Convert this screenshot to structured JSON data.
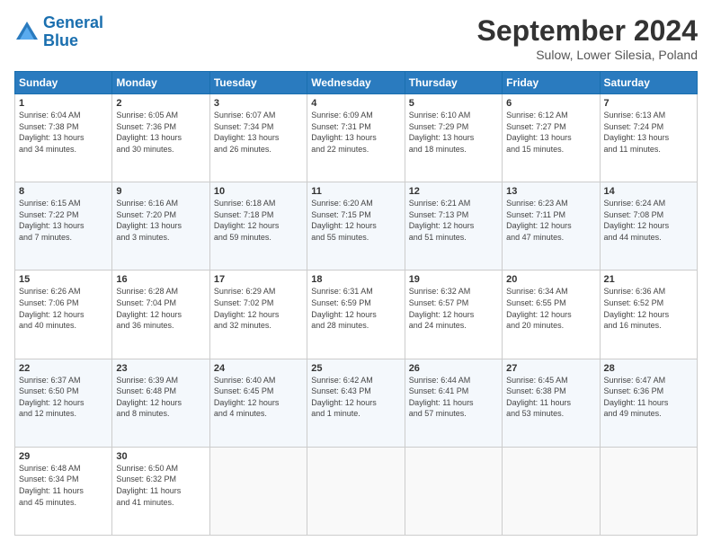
{
  "header": {
    "logo_line1": "General",
    "logo_line2": "Blue",
    "month_title": "September 2024",
    "subtitle": "Sulow, Lower Silesia, Poland"
  },
  "days_of_week": [
    "Sunday",
    "Monday",
    "Tuesday",
    "Wednesday",
    "Thursday",
    "Friday",
    "Saturday"
  ],
  "weeks": [
    [
      {
        "day": "1",
        "info": "Sunrise: 6:04 AM\nSunset: 7:38 PM\nDaylight: 13 hours\nand 34 minutes."
      },
      {
        "day": "2",
        "info": "Sunrise: 6:05 AM\nSunset: 7:36 PM\nDaylight: 13 hours\nand 30 minutes."
      },
      {
        "day": "3",
        "info": "Sunrise: 6:07 AM\nSunset: 7:34 PM\nDaylight: 13 hours\nand 26 minutes."
      },
      {
        "day": "4",
        "info": "Sunrise: 6:09 AM\nSunset: 7:31 PM\nDaylight: 13 hours\nand 22 minutes."
      },
      {
        "day": "5",
        "info": "Sunrise: 6:10 AM\nSunset: 7:29 PM\nDaylight: 13 hours\nand 18 minutes."
      },
      {
        "day": "6",
        "info": "Sunrise: 6:12 AM\nSunset: 7:27 PM\nDaylight: 13 hours\nand 15 minutes."
      },
      {
        "day": "7",
        "info": "Sunrise: 6:13 AM\nSunset: 7:24 PM\nDaylight: 13 hours\nand 11 minutes."
      }
    ],
    [
      {
        "day": "8",
        "info": "Sunrise: 6:15 AM\nSunset: 7:22 PM\nDaylight: 13 hours\nand 7 minutes."
      },
      {
        "day": "9",
        "info": "Sunrise: 6:16 AM\nSunset: 7:20 PM\nDaylight: 13 hours\nand 3 minutes."
      },
      {
        "day": "10",
        "info": "Sunrise: 6:18 AM\nSunset: 7:18 PM\nDaylight: 12 hours\nand 59 minutes."
      },
      {
        "day": "11",
        "info": "Sunrise: 6:20 AM\nSunset: 7:15 PM\nDaylight: 12 hours\nand 55 minutes."
      },
      {
        "day": "12",
        "info": "Sunrise: 6:21 AM\nSunset: 7:13 PM\nDaylight: 12 hours\nand 51 minutes."
      },
      {
        "day": "13",
        "info": "Sunrise: 6:23 AM\nSunset: 7:11 PM\nDaylight: 12 hours\nand 47 minutes."
      },
      {
        "day": "14",
        "info": "Sunrise: 6:24 AM\nSunset: 7:08 PM\nDaylight: 12 hours\nand 44 minutes."
      }
    ],
    [
      {
        "day": "15",
        "info": "Sunrise: 6:26 AM\nSunset: 7:06 PM\nDaylight: 12 hours\nand 40 minutes."
      },
      {
        "day": "16",
        "info": "Sunrise: 6:28 AM\nSunset: 7:04 PM\nDaylight: 12 hours\nand 36 minutes."
      },
      {
        "day": "17",
        "info": "Sunrise: 6:29 AM\nSunset: 7:02 PM\nDaylight: 12 hours\nand 32 minutes."
      },
      {
        "day": "18",
        "info": "Sunrise: 6:31 AM\nSunset: 6:59 PM\nDaylight: 12 hours\nand 28 minutes."
      },
      {
        "day": "19",
        "info": "Sunrise: 6:32 AM\nSunset: 6:57 PM\nDaylight: 12 hours\nand 24 minutes."
      },
      {
        "day": "20",
        "info": "Sunrise: 6:34 AM\nSunset: 6:55 PM\nDaylight: 12 hours\nand 20 minutes."
      },
      {
        "day": "21",
        "info": "Sunrise: 6:36 AM\nSunset: 6:52 PM\nDaylight: 12 hours\nand 16 minutes."
      }
    ],
    [
      {
        "day": "22",
        "info": "Sunrise: 6:37 AM\nSunset: 6:50 PM\nDaylight: 12 hours\nand 12 minutes."
      },
      {
        "day": "23",
        "info": "Sunrise: 6:39 AM\nSunset: 6:48 PM\nDaylight: 12 hours\nand 8 minutes."
      },
      {
        "day": "24",
        "info": "Sunrise: 6:40 AM\nSunset: 6:45 PM\nDaylight: 12 hours\nand 4 minutes."
      },
      {
        "day": "25",
        "info": "Sunrise: 6:42 AM\nSunset: 6:43 PM\nDaylight: 12 hours\nand 1 minute."
      },
      {
        "day": "26",
        "info": "Sunrise: 6:44 AM\nSunset: 6:41 PM\nDaylight: 11 hours\nand 57 minutes."
      },
      {
        "day": "27",
        "info": "Sunrise: 6:45 AM\nSunset: 6:38 PM\nDaylight: 11 hours\nand 53 minutes."
      },
      {
        "day": "28",
        "info": "Sunrise: 6:47 AM\nSunset: 6:36 PM\nDaylight: 11 hours\nand 49 minutes."
      }
    ],
    [
      {
        "day": "29",
        "info": "Sunrise: 6:48 AM\nSunset: 6:34 PM\nDaylight: 11 hours\nand 45 minutes."
      },
      {
        "day": "30",
        "info": "Sunrise: 6:50 AM\nSunset: 6:32 PM\nDaylight: 11 hours\nand 41 minutes."
      },
      {
        "day": "",
        "info": ""
      },
      {
        "day": "",
        "info": ""
      },
      {
        "day": "",
        "info": ""
      },
      {
        "day": "",
        "info": ""
      },
      {
        "day": "",
        "info": ""
      }
    ]
  ]
}
